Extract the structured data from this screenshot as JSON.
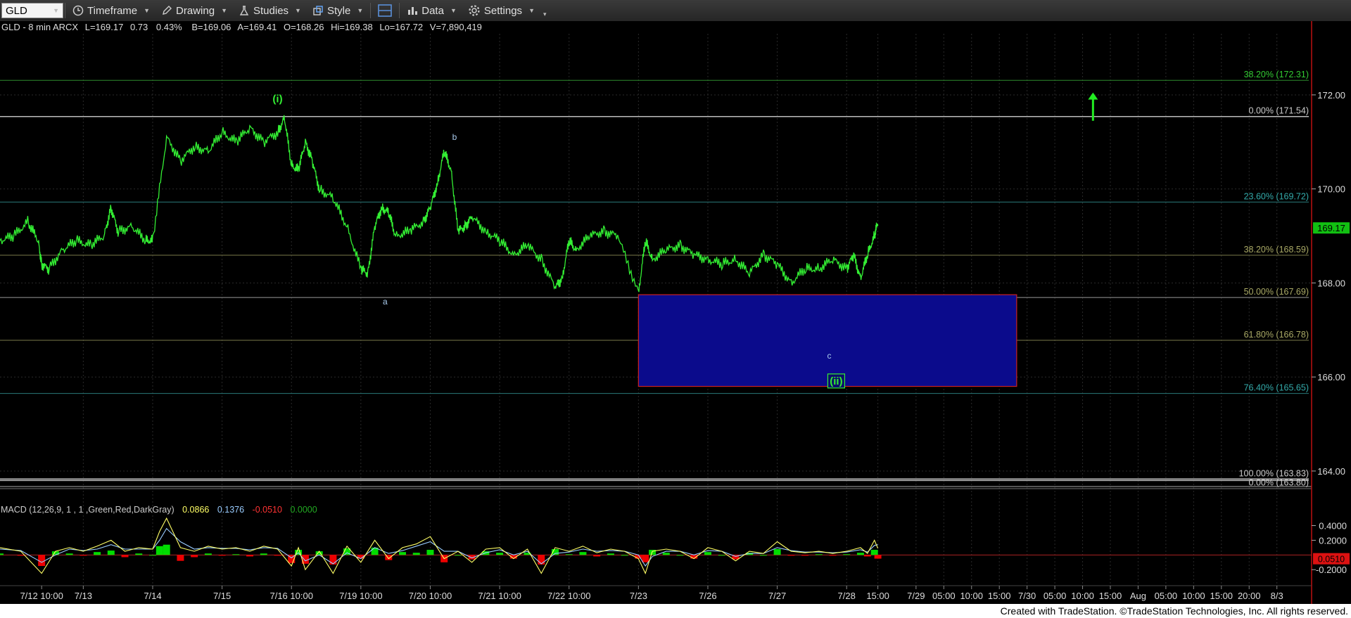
{
  "toolbar": {
    "symbol": "GLD",
    "timeframe_label": "Timeframe",
    "drawing_label": "Drawing",
    "studies_label": "Studies",
    "style_label": "Style",
    "data_label": "Data",
    "settings_label": "Settings"
  },
  "header": {
    "symbol_line": "GLD - 8 min  ARCX",
    "last": "L=169.17",
    "change": "0.73",
    "change_pct": "0.43%",
    "bid": "B=169.06",
    "ask": "A=169.41",
    "open": "O=168.26",
    "high": "Hi=169.38",
    "low": "Lo=167.72",
    "volume": "V=7,890,419"
  },
  "macd_header": {
    "label": "MACD (12,26,9, 1 , 1 ,Green,Red,DarkGray)",
    "v1": "0.0866",
    "v2": "0.1376",
    "v3": "-0.0510",
    "v4": "0.0000"
  },
  "footer": {
    "text": "Created with TradeStation. ©TradeStation Technologies, Inc. All rights reserved."
  },
  "colors": {
    "price": "#33ee33",
    "zone_fill": "#0b0b8c",
    "zone_border": "#cc2222",
    "macd_pos": "#00dd00",
    "macd_neg": "#ee0000",
    "fast_line": "#ffff66",
    "slow_line": "#99ccff"
  },
  "chart_data": {
    "type": "line",
    "title": "GLD - 8 min",
    "ylim": [
      163.7,
      173.3
    ],
    "price_ticks": [
      "172.00",
      "170.00",
      "168.00",
      "166.00",
      "164.00"
    ],
    "price_tick_values": [
      172,
      170,
      168,
      166,
      164
    ],
    "last_price_label": "169.17",
    "last_price": 169.17,
    "x_labels": [
      "7/12 10:00",
      "7/13",
      "7/14",
      "7/15",
      "7/16 10:00",
      "7/19 10:00",
      "7/20 10:00",
      "7/21 10:00",
      "7/22 10:00",
      "7/23",
      "7/26",
      "7/27",
      "7/28",
      "15:00",
      "7/29",
      "05:00",
      "10:00",
      "15:00",
      "7/30",
      "05:00",
      "10:00",
      "15:00",
      "Aug",
      "05:00",
      "10:00",
      "15:00",
      "20:00",
      "8/3"
    ],
    "x_positions": [
      0.0,
      0.6,
      1.6,
      2.6,
      3.6,
      4.6,
      5.6,
      6.6,
      7.6,
      8.6,
      9.6,
      10.6,
      11.6,
      12.05,
      12.6,
      13.0,
      13.4,
      13.8,
      14.2,
      14.6,
      15.0,
      15.4,
      15.8,
      16.2,
      16.6,
      17.0,
      17.4,
      17.8
    ],
    "xlim": [
      -0.6,
      18.3
    ],
    "fib_levels": [
      {
        "label": "38.20% (172.31)",
        "value": 172.31,
        "color": "#2e8b2e"
      },
      {
        "label": "0.00% (171.54)",
        "value": 171.54,
        "color": "#bbbbbb"
      },
      {
        "label": "23.60% (169.72)",
        "value": 169.72,
        "color": "#2a7a7a"
      },
      {
        "label": "38.20% (168.59)",
        "value": 168.59,
        "color": "#7a7a4a"
      },
      {
        "label": "50.00% (167.69)",
        "value": 167.69,
        "color": "#999999"
      },
      {
        "label": "61.80% (166.78)",
        "value": 166.78,
        "color": "#7a7a4a"
      },
      {
        "label": "76.40% (165.65)",
        "value": 165.65,
        "color": "#2a7a7a"
      },
      {
        "label": "100.00% (163.83)",
        "value": 163.83,
        "color": "#bbbbbb"
      },
      {
        "label": "0.00% (163.80)",
        "value": 163.8,
        "color": "#bbbbbb"
      }
    ],
    "zone": {
      "x_start": 8.6,
      "x_end": 14.05,
      "y_top": 167.75,
      "y_bottom": 165.8
    },
    "annotations": [
      {
        "text": "(i)",
        "x": 3.4,
        "y": 171.9,
        "color": "#33ee33",
        "boxed": false
      },
      {
        "text": "b",
        "x": 5.95,
        "y": 171.1,
        "color": "#aaccee",
        "boxed": false
      },
      {
        "text": "a",
        "x": 4.95,
        "y": 167.6,
        "color": "#aaccee",
        "boxed": false
      },
      {
        "text": "c",
        "x": 11.35,
        "y": 166.45,
        "color": "#aaccee",
        "boxed": false
      },
      {
        "text": "(ii)",
        "x": 11.45,
        "y": 165.9,
        "color": "#33ee33",
        "boxed": true
      }
    ],
    "arrow": {
      "x": 15.15,
      "y_from": 171.45,
      "y_to": 172.05
    },
    "series": [
      {
        "x": [
          -0.6,
          -0.4,
          -0.2,
          -0.05,
          0.0,
          0.1,
          0.3,
          0.5,
          0.7,
          0.9,
          1.0,
          1.1,
          1.3,
          1.5,
          1.6,
          1.8,
          2.0,
          2.2,
          2.4,
          2.6,
          2.8,
          3.0,
          3.2,
          3.4,
          3.5,
          3.6,
          3.7,
          3.8,
          3.9,
          4.0,
          4.2,
          4.4,
          4.6,
          4.7,
          4.8,
          4.9,
          5.0,
          5.1,
          5.3,
          5.5,
          5.6,
          5.7,
          5.8,
          5.9,
          6.0,
          6.1,
          6.2,
          6.4,
          6.6,
          6.8,
          7.0,
          7.2,
          7.4,
          7.5,
          7.6,
          7.7,
          7.9,
          8.1,
          8.3,
          8.6,
          8.7,
          8.8,
          9.0,
          9.2,
          9.4,
          9.6,
          9.8,
          10.0,
          10.2,
          10.4,
          10.6,
          10.8,
          11.0,
          11.2,
          11.4,
          11.6,
          11.7,
          11.8,
          11.9,
          12.0,
          12.05
        ],
        "y": [
          168.9,
          169.0,
          169.3,
          168.9,
          168.4,
          168.3,
          168.7,
          168.9,
          168.8,
          169.0,
          169.6,
          169.1,
          169.2,
          168.9,
          168.9,
          171.1,
          170.6,
          170.9,
          170.8,
          171.2,
          171.0,
          171.3,
          171.0,
          171.2,
          171.5,
          170.5,
          170.4,
          171.0,
          170.6,
          170.0,
          169.8,
          169.2,
          168.3,
          168.2,
          169.2,
          169.6,
          169.5,
          169.0,
          169.1,
          169.3,
          169.6,
          170.1,
          170.8,
          170.4,
          169.1,
          169.2,
          169.4,
          169.1,
          168.9,
          168.6,
          168.8,
          168.5,
          167.9,
          168.1,
          168.9,
          168.7,
          169.0,
          169.1,
          169.0,
          167.8,
          168.9,
          168.5,
          168.7,
          168.8,
          168.6,
          168.5,
          168.4,
          168.5,
          168.2,
          168.6,
          168.4,
          168.0,
          168.3,
          168.3,
          168.5,
          168.3,
          168.6,
          168.1,
          168.6,
          169.0,
          169.3
        ]
      }
    ],
    "macd_ticks": [
      "0.4000",
      "0.2000",
      "-0.2000"
    ],
    "macd_tick_values": [
      0.4,
      0.2,
      -0.2
    ],
    "macd_ylim": [
      -0.37,
      0.52
    ],
    "macd_current_label": "0.0510",
    "macd_current": -0.051,
    "macd": {
      "x": [
        -0.6,
        -0.3,
        0.0,
        0.2,
        0.4,
        0.6,
        0.8,
        1.0,
        1.2,
        1.4,
        1.6,
        1.7,
        1.8,
        2.0,
        2.2,
        2.4,
        2.6,
        2.8,
        3.0,
        3.2,
        3.4,
        3.6,
        3.7,
        3.8,
        4.0,
        4.2,
        4.4,
        4.6,
        4.8,
        5.0,
        5.2,
        5.4,
        5.6,
        5.8,
        6.0,
        6.2,
        6.4,
        6.6,
        6.8,
        7.0,
        7.2,
        7.4,
        7.6,
        7.8,
        8.0,
        8.2,
        8.4,
        8.6,
        8.7,
        8.8,
        9.0,
        9.2,
        9.4,
        9.6,
        9.8,
        10.0,
        10.2,
        10.4,
        10.6,
        10.8,
        11.0,
        11.2,
        11.4,
        11.6,
        11.8,
        11.9,
        12.0,
        12.05
      ],
      "fast": [
        0.1,
        0.05,
        -0.25,
        0.05,
        0.1,
        0.05,
        0.12,
        0.2,
        0.05,
        0.1,
        0.08,
        0.32,
        0.5,
        0.1,
        0.05,
        0.12,
        0.08,
        0.1,
        0.05,
        0.12,
        0.08,
        -0.15,
        0.1,
        -0.2,
        0.05,
        -0.25,
        0.12,
        -0.1,
        0.2,
        -0.05,
        0.1,
        0.15,
        0.25,
        -0.05,
        0.05,
        -0.1,
        0.08,
        0.1,
        -0.05,
        0.08,
        -0.25,
        0.1,
        0.05,
        0.12,
        0.03,
        0.08,
        0.05,
        -0.05,
        -0.25,
        0.05,
        0.08,
        0.05,
        -0.05,
        0.1,
        0.05,
        -0.08,
        0.05,
        0.02,
        0.18,
        0.05,
        0.03,
        0.05,
        0.02,
        0.05,
        0.1,
        0.02,
        0.2,
        0.09
      ],
      "slow": [
        0.08,
        0.06,
        -0.1,
        0.0,
        0.08,
        0.06,
        0.08,
        0.14,
        0.08,
        0.08,
        0.08,
        0.2,
        0.36,
        0.18,
        0.08,
        0.1,
        0.09,
        0.09,
        0.07,
        0.1,
        0.09,
        -0.04,
        0.03,
        -0.08,
        0.0,
        -0.12,
        0.03,
        -0.05,
        0.1,
        0.02,
        0.06,
        0.12,
        0.18,
        0.05,
        0.05,
        -0.04,
        0.03,
        0.07,
        0.0,
        0.05,
        -0.12,
        0.02,
        0.04,
        0.08,
        0.05,
        0.06,
        0.05,
        0.0,
        -0.15,
        -0.02,
        0.05,
        0.05,
        0.0,
        0.06,
        0.05,
        -0.02,
        0.02,
        0.02,
        0.1,
        0.06,
        0.04,
        0.04,
        0.03,
        0.04,
        0.07,
        0.04,
        0.13,
        0.14
      ]
    }
  }
}
